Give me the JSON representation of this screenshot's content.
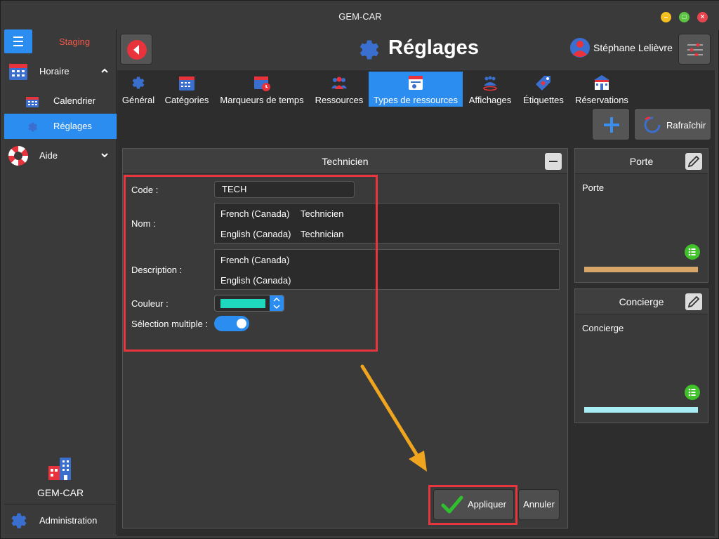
{
  "window": {
    "title": "GEM-CAR"
  },
  "sidebar": {
    "environment": "Staging",
    "items": [
      {
        "label": "Horaire",
        "expanded": true
      },
      {
        "label": "Calendrier"
      },
      {
        "label": "Réglages",
        "active": true
      },
      {
        "label": "Aide",
        "expanded": false
      }
    ],
    "logo_text": "GEM-CAR",
    "admin_label": "Administration"
  },
  "header": {
    "title": "Réglages",
    "user_name": "Stéphane Lelièvre"
  },
  "tabs": [
    {
      "label": "Général",
      "icon": "gear-icon"
    },
    {
      "label": "Catégories",
      "icon": "calendar-grid-icon"
    },
    {
      "label": "Marqueurs de temps",
      "icon": "calendar-clock-icon"
    },
    {
      "label": "Ressources",
      "icon": "people-icon"
    },
    {
      "label": "Types de ressources",
      "icon": "resource-type-icon",
      "active": true
    },
    {
      "label": "Affichages",
      "icon": "group-display-icon"
    },
    {
      "label": "Étiquettes",
      "icon": "tag-icon"
    },
    {
      "label": "Réservations",
      "icon": "building-icon"
    }
  ],
  "toolbar": {
    "refresh_label": "Rafraîchir"
  },
  "panel": {
    "title": "Technicien",
    "code_label": "Code :",
    "code_value": "TECH",
    "name_label": "Nom :",
    "name_values": [
      {
        "lang": "French (Canada)",
        "value": "Technicien"
      },
      {
        "lang": "English (Canada)",
        "value": "Technician"
      }
    ],
    "description_label": "Description :",
    "description_values": [
      {
        "lang": "French (Canada)",
        "value": ""
      },
      {
        "lang": "English (Canada)",
        "value": ""
      }
    ],
    "color_label": "Couleur :",
    "color_value": "#1fd6bf",
    "multi_label": "Sélection multiple :",
    "multi_enabled": true,
    "apply_label": "Appliquer",
    "cancel_label": "Annuler"
  },
  "cards": [
    {
      "title": "Porte",
      "body": "Porte",
      "color": "#d9a66a"
    },
    {
      "title": "Concierge",
      "body": "Concierge",
      "color": "#a8ecf6"
    }
  ],
  "colors": {
    "accent": "#2b8df0",
    "highlight": "#e8363f",
    "arrow": "#f0a51e"
  }
}
